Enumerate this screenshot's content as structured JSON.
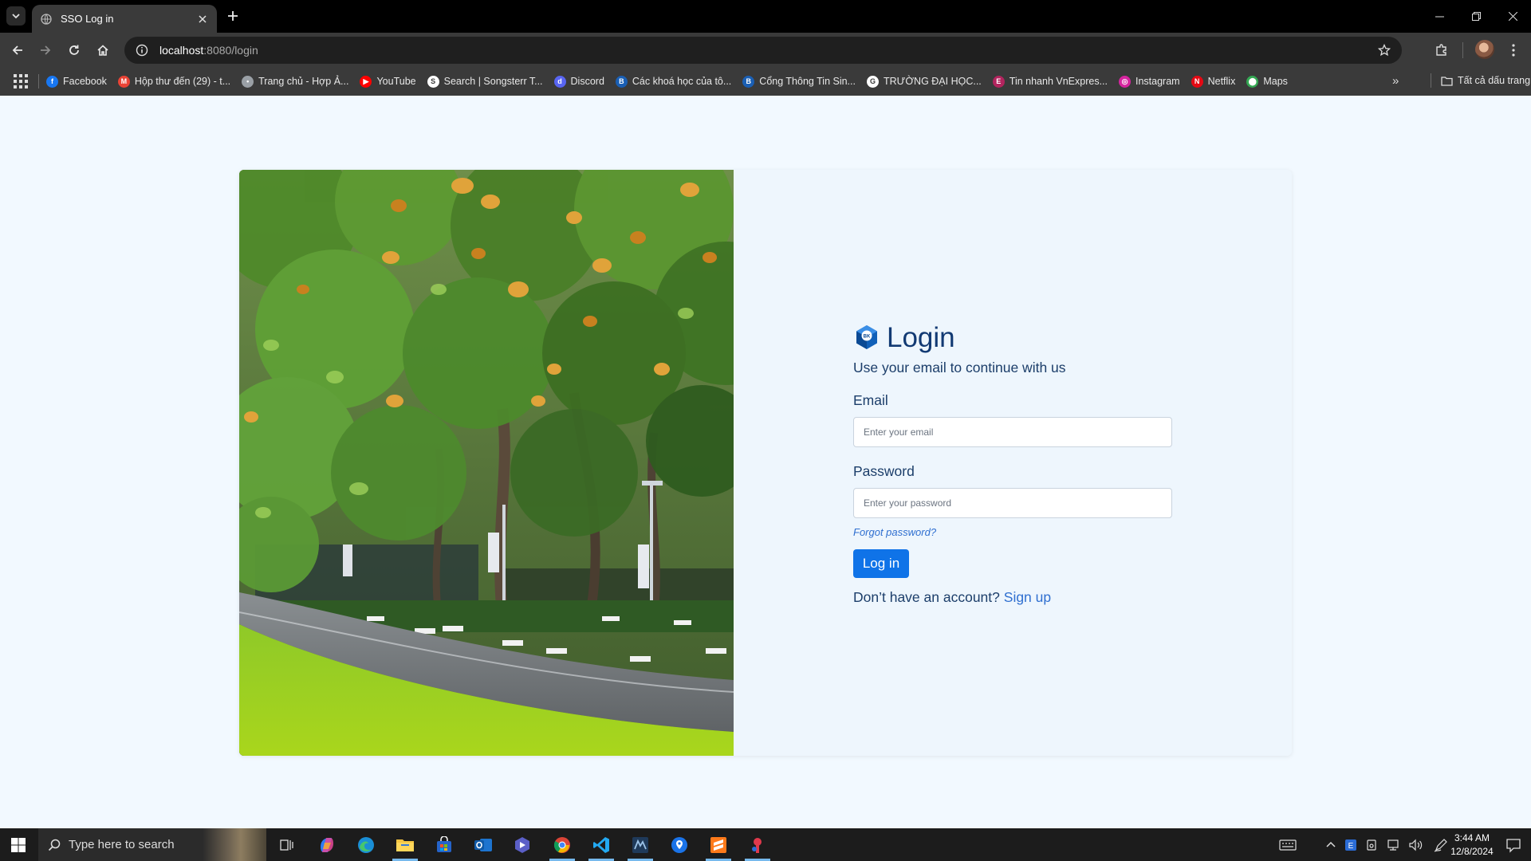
{
  "browser": {
    "tab": {
      "title": "SSO Log in"
    },
    "url": {
      "host": "localhost",
      "rest": ":8080/login"
    },
    "bookmarks": [
      {
        "label": "Facebook",
        "icon": "facebook-icon",
        "color": "#1877f2",
        "glyph": "f"
      },
      {
        "label": "Hộp thư đến (29) - t...",
        "icon": "gmail-icon",
        "color": "#ea4335",
        "glyph": "M"
      },
      {
        "label": "Trang chủ - Hợp Ả...",
        "icon": "page-icon",
        "color": "#9aa0a6",
        "glyph": "•"
      },
      {
        "label": "YouTube",
        "icon": "youtube-icon",
        "color": "#ff0000",
        "glyph": "▶"
      },
      {
        "label": "Search | Songsterr T...",
        "icon": "songsterr-icon",
        "color": "#ffffff",
        "glyph": "S"
      },
      {
        "label": "Discord",
        "icon": "discord-icon",
        "color": "#5865f2",
        "glyph": "d"
      },
      {
        "label": "Các khoá học của tô...",
        "icon": "bk-icon",
        "color": "#1a5fb4",
        "glyph": "B"
      },
      {
        "label": "Cổng Thông Tin Sin...",
        "icon": "bk-icon",
        "color": "#1a5fb4",
        "glyph": "B"
      },
      {
        "label": "TRƯỜNG ĐẠI HỌC...",
        "icon": "google-icon",
        "color": "#ffffff",
        "glyph": "G"
      },
      {
        "label": "Tin nhanh VnExpres...",
        "icon": "vnexpress-icon",
        "color": "#b3245e",
        "glyph": "E"
      },
      {
        "label": "Instagram",
        "icon": "instagram-icon",
        "color": "#d6249f",
        "glyph": "◎"
      },
      {
        "label": "Netflix",
        "icon": "netflix-icon",
        "color": "#e50914",
        "glyph": "N"
      },
      {
        "label": "Maps",
        "icon": "maps-icon",
        "color": "#34a853",
        "glyph": "⬤"
      }
    ],
    "all_bookmarks_label": "Tất cả dấu trang"
  },
  "login": {
    "title": "Login",
    "subtitle": "Use your email to continue with us",
    "email_label": "Email",
    "email_placeholder": "Enter your email",
    "password_label": "Password",
    "password_placeholder": "Enter your password",
    "forgot_label": "Forgot password?",
    "login_button": "Log in",
    "signup_prompt": "Don’t have an account?",
    "signup_link": "Sign up"
  },
  "taskbar": {
    "search_placeholder": "Type here to search",
    "time": "3:44 AM",
    "date": "12/8/2024"
  },
  "colors": {
    "page_bg": "#f2f9ff",
    "primary_button": "#0f73e8",
    "title_navy": "#123a73",
    "link_blue": "#2f6fd0"
  }
}
